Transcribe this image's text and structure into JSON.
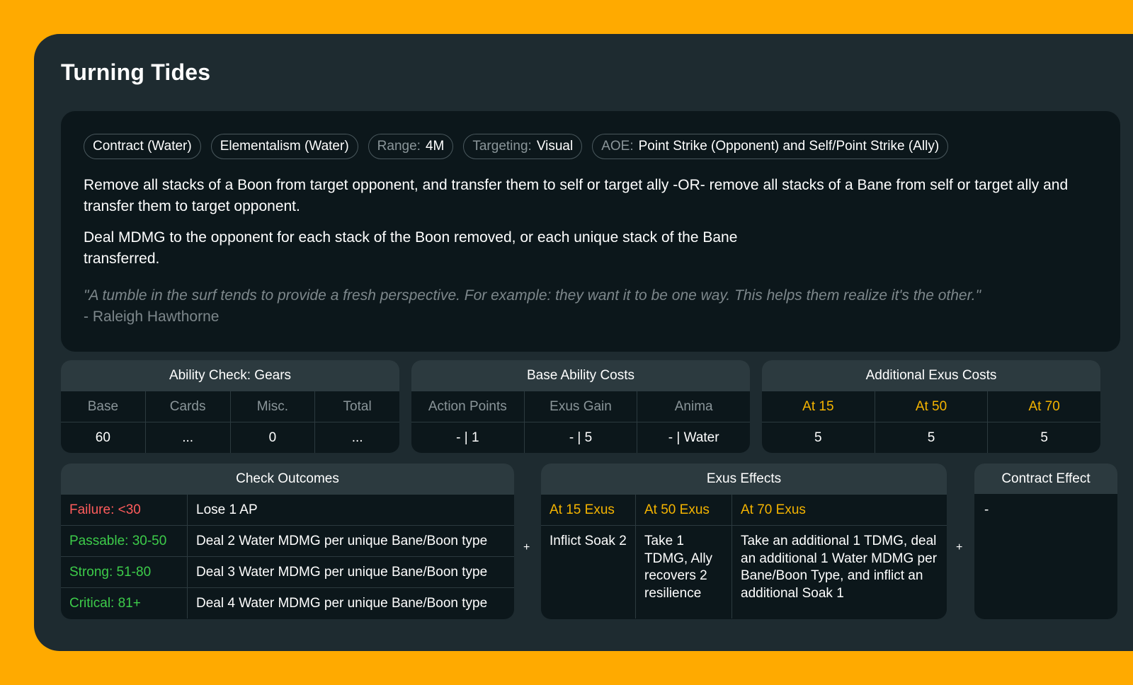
{
  "title": "Turning Tides",
  "tags": [
    {
      "key": "",
      "value": "Contract (Water)"
    },
    {
      "key": "",
      "value": "Elementalism (Water)"
    },
    {
      "key": "Range:",
      "value": "4M"
    },
    {
      "key": "Targeting:",
      "value": "Visual"
    },
    {
      "key": "AOE:",
      "value": "Point Strike (Opponent) and Self/Point Strike (Ally)"
    }
  ],
  "description": [
    "Remove all stacks of a Boon from target opponent, and transfer them to self or target ally -OR- remove all stacks of a Bane from self or target ally and transfer them to target opponent.",
    "Deal MDMG to the opponent for each stack of the Boon removed, or each unique stack of the Bane transferred."
  ],
  "quote": {
    "text": "\"A tumble in the surf tends to provide a fresh perspective. For example: they want it to be one way. This helps them realize it's the other.\"",
    "author": "- Raleigh Hawthorne"
  },
  "ability_check": {
    "header": "Ability Check: Gears",
    "columns": [
      "Base",
      "Cards",
      "Misc.",
      "Total"
    ],
    "values": [
      "60",
      "...",
      "0",
      "..."
    ]
  },
  "base_costs": {
    "header": "Base Ability Costs",
    "columns": [
      "Action Points",
      "Exus Gain",
      "Anima"
    ],
    "values": [
      "- | 1",
      "- | 5",
      "- | Water"
    ]
  },
  "additional_costs": {
    "header": "Additional Exus Costs",
    "columns": [
      "At 15",
      "At 50",
      "At 70"
    ],
    "values": [
      "5",
      "5",
      "5"
    ]
  },
  "check_outcomes": {
    "header": "Check Outcomes",
    "rows": [
      {
        "label": "Failure: <30",
        "effect": "Lose 1 AP",
        "color": "#ff5c5c"
      },
      {
        "label": "Passable: 30-50",
        "effect": "Deal 2 Water MDMG per unique Bane/Boon type",
        "color": "#3dcc4a"
      },
      {
        "label": "Strong: 51-80",
        "effect": "Deal 3 Water MDMG per unique Bane/Boon type",
        "color": "#3dcc4a"
      },
      {
        "label": "Critical: 81+",
        "effect": "Deal 4 Water MDMG per unique Bane/Boon type",
        "color": "#3dcc4a"
      }
    ]
  },
  "plus_sign": "+",
  "exus_effects": {
    "header": "Exus Effects",
    "columns": [
      "At 15 Exus",
      "At 50 Exus",
      "At 70 Exus"
    ],
    "values": [
      "Inflict Soak 2",
      "Take 1 TDMG, Ally recovers 2 resilience",
      "Take an additional 1 TDMG, deal an additional 1 Water MDMG per Bane/Boon Type, and inflict an additional Soak 1"
    ]
  },
  "contract_effect": {
    "header": "Contract Effect",
    "value": "-"
  },
  "colors": {
    "background": "#FFAA00",
    "card": "#1e2b30",
    "panel": "#0c171b",
    "header_row": "#2c3a3f",
    "gold": "#f5b400",
    "failure": "#ff5c5c",
    "success": "#3dcc4a"
  }
}
